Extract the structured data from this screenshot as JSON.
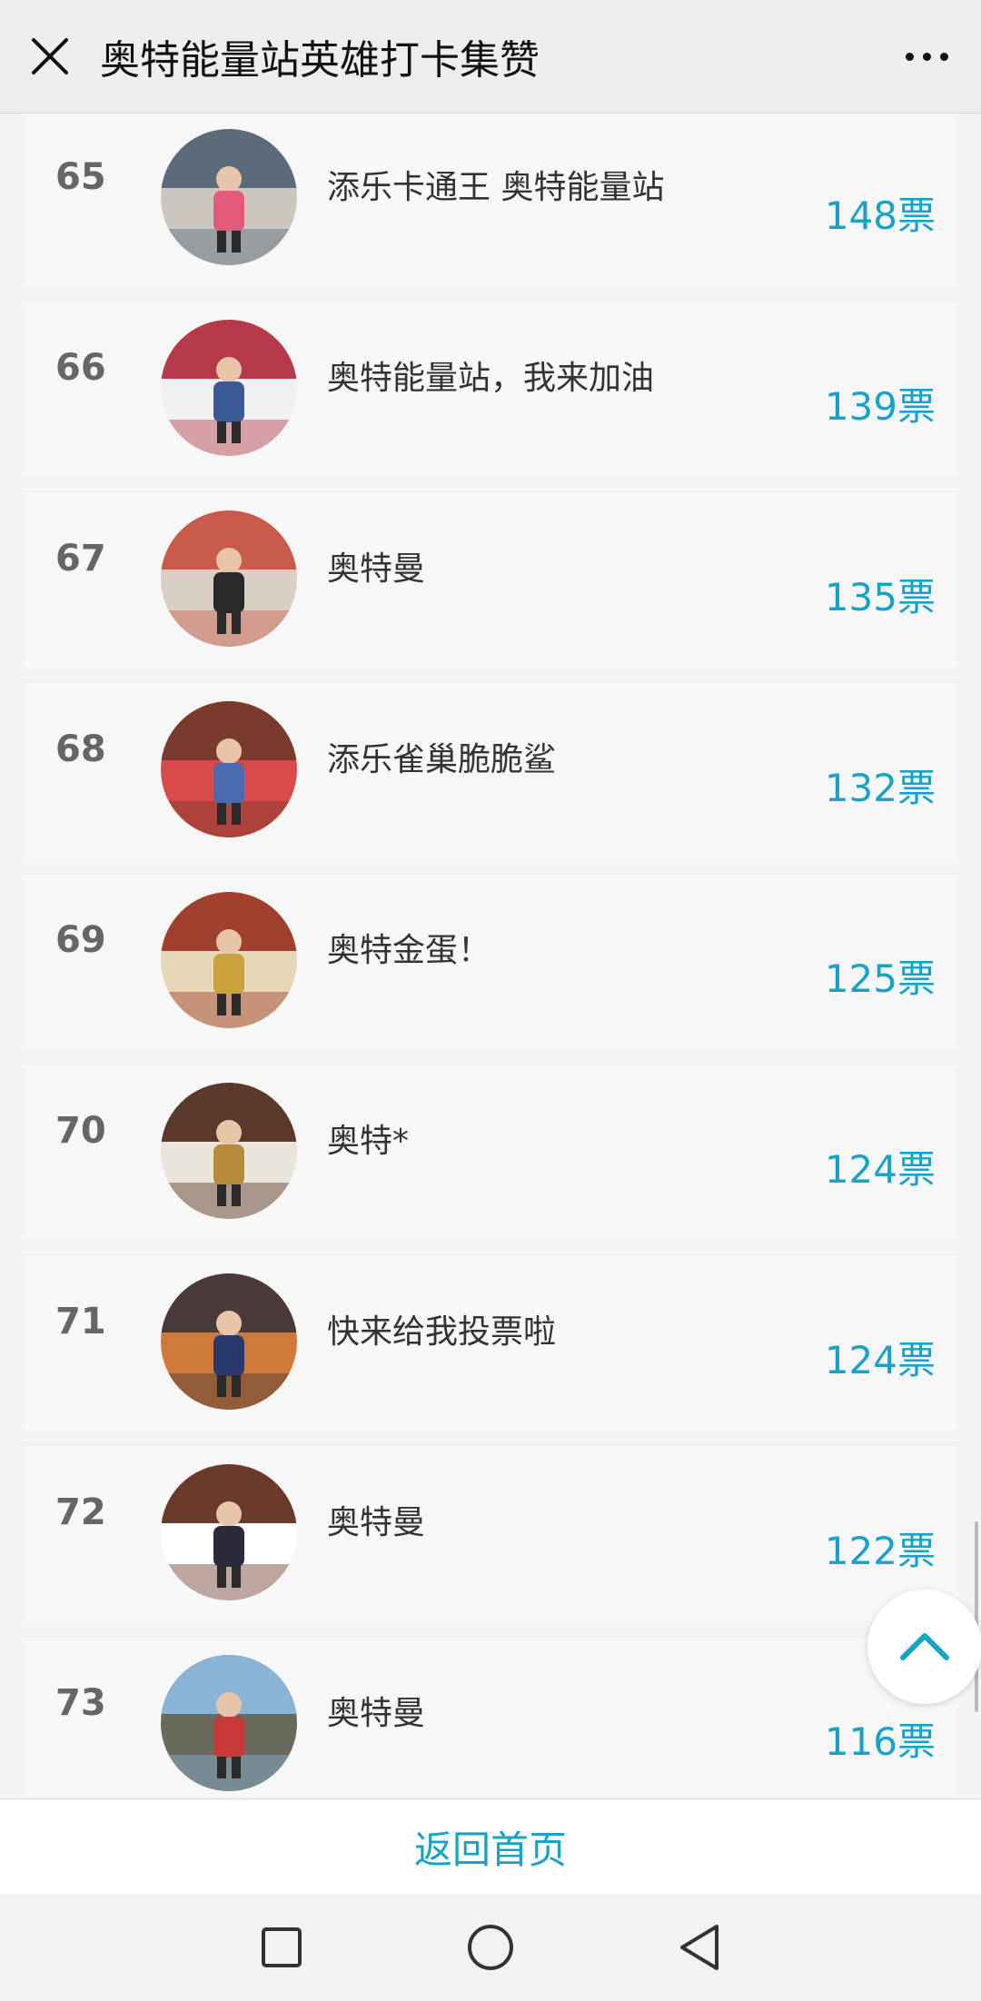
{
  "topbar": {
    "title": "奥特能量站英雄打卡集赞",
    "close_icon": "close-icon",
    "more_icon": "more-icon"
  },
  "entries": [
    {
      "rank": "65",
      "name": "添乐卡通王 奥特能量站",
      "votes": "148票",
      "avatar_colors": [
        "#5c6b7a",
        "#c9c7bf",
        "#e35a7a"
      ]
    },
    {
      "rank": "66",
      "name": "奥特能量站，我来加油",
      "votes": "139票",
      "avatar_colors": [
        "#b63a4a",
        "#f1f1f1",
        "#3c5a96"
      ]
    },
    {
      "rank": "67",
      "name": "奥特曼",
      "votes": "135票",
      "avatar_colors": [
        "#c85b4c",
        "#d9d0c3",
        "#2a2a2a"
      ]
    },
    {
      "rank": "68",
      "name": "添乐雀巢脆脆鲨",
      "votes": "132票",
      "avatar_colors": [
        "#7a3b2d",
        "#d94a4a",
        "#4a6bb0"
      ]
    },
    {
      "rank": "69",
      "name": "奥特金蛋！",
      "votes": "125票",
      "avatar_colors": [
        "#a0412f",
        "#e6d7b7",
        "#c8a23c"
      ]
    },
    {
      "rank": "70",
      "name": "奥特*",
      "votes": "124票",
      "avatar_colors": [
        "#5a3a2a",
        "#e9e4dc",
        "#b78a3a"
      ]
    },
    {
      "rank": "71",
      "name": "快来给我投票啦",
      "votes": "124票",
      "avatar_colors": [
        "#4a3a3a",
        "#cf7a3a",
        "#2a3a6a"
      ]
    },
    {
      "rank": "72",
      "name": "奥特曼",
      "votes": "122票",
      "avatar_colors": [
        "#6a3a2a",
        "#ffffff",
        "#2a2a3a"
      ]
    },
    {
      "rank": "73",
      "name": "奥特曼",
      "votes": "116票",
      "avatar_colors": [
        "#8ab4d6",
        "#6a6a5a",
        "#c83a3a"
      ]
    }
  ],
  "scroll_top_icon": "chevron-up-icon",
  "bottom": {
    "home_link": "返回首页"
  },
  "android_nav": {
    "recent_icon": "square-icon",
    "home_icon": "circle-icon",
    "back_icon": "triangle-back-icon"
  },
  "colors": {
    "accent": "#19a2c8",
    "rank": "#666666",
    "background": "#f4f4f4"
  }
}
